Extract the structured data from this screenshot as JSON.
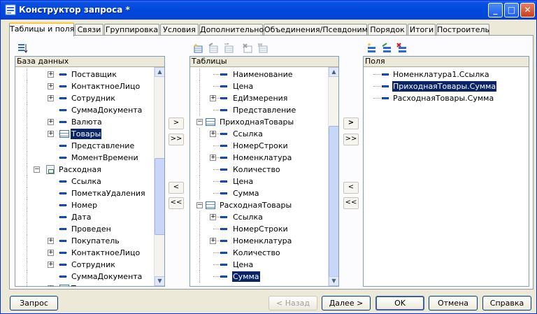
{
  "window": {
    "title": "Конструктор запроса *",
    "min": "_",
    "max": "□",
    "close": "✕"
  },
  "tabs": [
    "Таблицы и поля",
    "Связи",
    "Группировка",
    "Условия",
    "Дополнительно",
    "Объединения/Псевдонимы",
    "Порядок",
    "Итоги",
    "Построитель"
  ],
  "database": {
    "header": "База данных",
    "items": [
      {
        "label": "Поставщик",
        "exp": true
      },
      {
        "label": "КонтактноеЛицо",
        "exp": true
      },
      {
        "label": "Сотрудник",
        "exp": true
      },
      {
        "label": "СуммаДокумента",
        "exp": false
      },
      {
        "label": "Валюта",
        "exp": true
      },
      {
        "label": "Товары",
        "exp": true,
        "table": true,
        "selected": true
      },
      {
        "label": "Представление",
        "exp": false
      },
      {
        "label": "МоментВремени",
        "exp": false
      },
      {
        "label": "Расходная",
        "doc": true,
        "exp": true,
        "expanded": true
      },
      {
        "label": "Ссылка",
        "exp": false
      },
      {
        "label": "ПометкаУдаления",
        "exp": false
      },
      {
        "label": "Номер",
        "exp": false
      },
      {
        "label": "Дата",
        "exp": false
      },
      {
        "label": "Проведен",
        "exp": false
      },
      {
        "label": "Покупатель",
        "exp": true
      },
      {
        "label": "КонтактноеЛицо",
        "exp": true
      },
      {
        "label": "Сотрудник",
        "exp": true
      },
      {
        "label": "СуммаДокумента",
        "exp": false
      },
      {
        "label": "Товары",
        "exp": true,
        "table": true
      }
    ]
  },
  "tables": {
    "header": "Таблицы",
    "items": [
      {
        "label": "Наименование",
        "exp": false
      },
      {
        "label": "Цена",
        "exp": false
      },
      {
        "label": "ЕдИзмерения",
        "exp": true
      },
      {
        "label": "Представление",
        "exp": false
      },
      {
        "label": "ПриходнаяТовары",
        "root": true
      },
      {
        "label": "Ссылка",
        "exp": true
      },
      {
        "label": "НомерСтроки",
        "exp": false
      },
      {
        "label": "Номенклатура",
        "exp": true
      },
      {
        "label": "Количество",
        "exp": false
      },
      {
        "label": "Цена",
        "exp": false
      },
      {
        "label": "Сумма",
        "exp": false
      },
      {
        "label": "РасходнаяТовары",
        "root": true
      },
      {
        "label": "Ссылка",
        "exp": true
      },
      {
        "label": "НомерСтроки",
        "exp": false
      },
      {
        "label": "Номенклатура",
        "exp": true
      },
      {
        "label": "Количество",
        "exp": false
      },
      {
        "label": "Цена",
        "exp": false
      },
      {
        "label": "Сумма",
        "exp": false,
        "selected": true
      }
    ]
  },
  "fields": {
    "header": "Поля",
    "items": [
      {
        "label": "Номенклатура1.Ссылка"
      },
      {
        "label": "ПриходнаяТовары.Сумма",
        "selected": true
      },
      {
        "label": "РасходнаяТовары.Сумма"
      }
    ]
  },
  "move": {
    "add": ">",
    "add_all": ">>",
    "remove": "<",
    "remove_all": "<<"
  },
  "buttons": {
    "query": "Запрос",
    "back": "< Назад",
    "next": "Далее >",
    "ok": "OK",
    "cancel": "Отмена",
    "help": "Справка"
  },
  "colors": {
    "title_bar": "#0047dd",
    "selection": "#0a246a",
    "tab_highlight": "#ffc83c"
  }
}
